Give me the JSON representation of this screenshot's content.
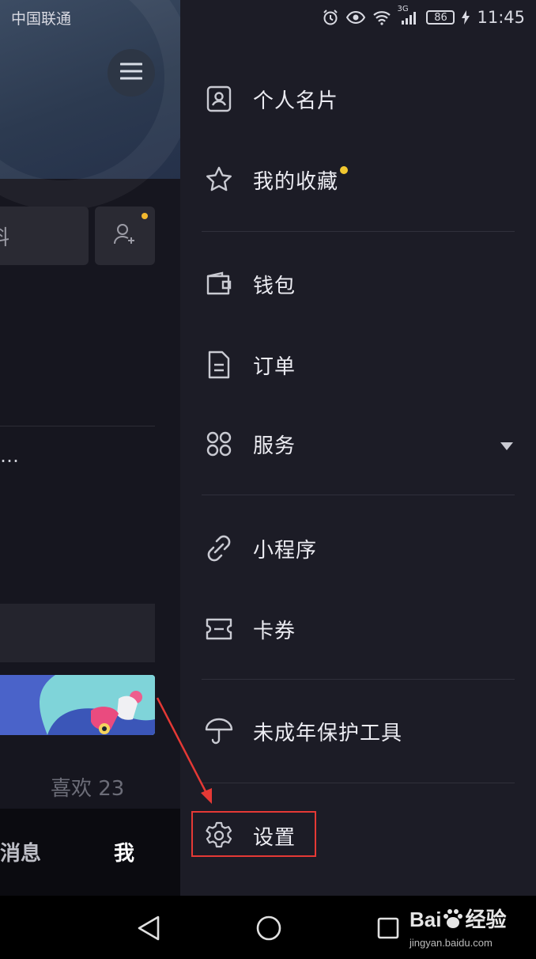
{
  "status_bar": {
    "carrier": "中国联通",
    "network": "3G",
    "battery": "86",
    "time": "11:45"
  },
  "background_app": {
    "edit_button_partial": "料",
    "ellipsis": "…",
    "likes": "喜欢 23",
    "nav_messages": "消息",
    "nav_me": "我"
  },
  "drawer": {
    "items": [
      {
        "label": "个人名片",
        "icon": "contact-card-icon"
      },
      {
        "label": "我的收藏",
        "icon": "star-icon"
      },
      {
        "label": "钱包",
        "icon": "wallet-icon"
      },
      {
        "label": "订单",
        "icon": "order-document-icon"
      },
      {
        "label": "服务",
        "icon": "services-grid-icon"
      },
      {
        "label": "小程序",
        "icon": "mini-program-link-icon"
      },
      {
        "label": "卡券",
        "icon": "coupon-ticket-icon"
      },
      {
        "label": "未成年保护工具",
        "icon": "umbrella-icon"
      },
      {
        "label": "设置",
        "icon": "gear-icon"
      }
    ],
    "accent_colors": {
      "badge": "#f2c830",
      "highlight": "#e53935"
    }
  },
  "watermark": {
    "logo_prefix": "Bai",
    "logo_suffix": "经验",
    "url": "jingyan.baidu.com"
  }
}
